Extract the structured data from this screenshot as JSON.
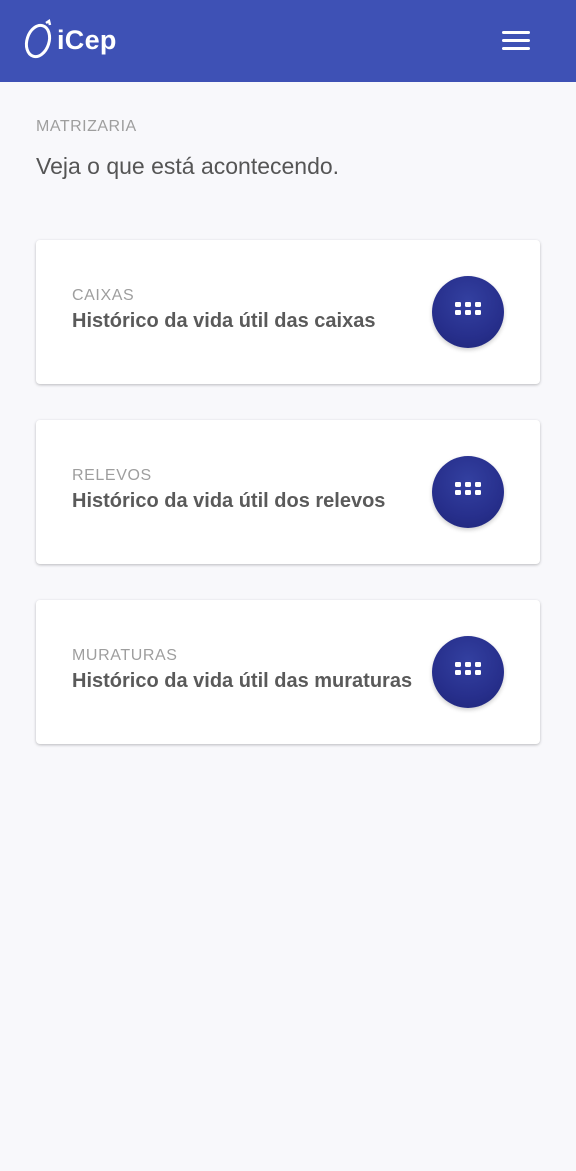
{
  "header": {
    "logo_text": "iCep",
    "logo_icon": "icep-logo-icon",
    "menu_icon": "hamburger-menu-icon",
    "background_color": "#3e51b5"
  },
  "page": {
    "section_label": "MATRIZARIA",
    "subtitle": "Veja o que está acontecendo."
  },
  "cards": [
    {
      "category": "CAIXAS",
      "title": "Histórico da vida útil das caixas",
      "button_icon": "apps-grid-icon"
    },
    {
      "category": "RELEVOS",
      "title": "Histórico da vida útil dos relevos",
      "button_icon": "apps-grid-icon"
    },
    {
      "category": "MURATURAS",
      "title": "Histórico da vida útil das muraturas",
      "button_icon": "apps-grid-icon"
    }
  ],
  "colors": {
    "accent": "#3e51b5",
    "button": "#272f8c",
    "background": "#f8f8fb"
  }
}
